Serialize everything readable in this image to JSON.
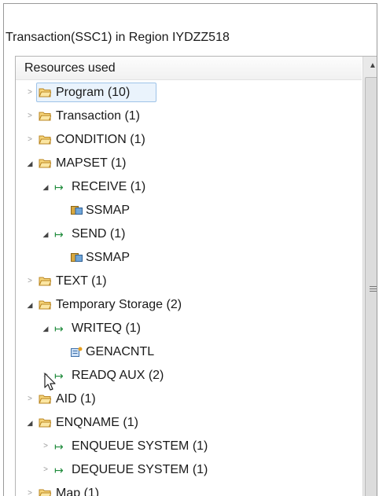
{
  "window": {
    "title": "Transaction(SSC1) in Region IYDZZ518"
  },
  "tree": {
    "header": "Resources used",
    "rows": [
      {
        "label": "Program",
        "count": "(10)",
        "icon": "folder-icon",
        "expanded": false,
        "selected": true
      },
      {
        "label": "Transaction",
        "count": "(1)",
        "icon": "folder-icon",
        "expanded": false
      },
      {
        "label": "CONDITION",
        "count": "(1)",
        "icon": "folder-icon",
        "expanded": false
      },
      {
        "label": "MAPSET",
        "count": "(1)",
        "icon": "folder-icon",
        "expanded": true
      },
      {
        "label": "RECEIVE",
        "count": "(1)",
        "icon": "arrow-icon",
        "expanded": true
      },
      {
        "label": "SSMAP",
        "count": "",
        "icon": "map-icon"
      },
      {
        "label": "SEND",
        "count": "(1)",
        "icon": "arrow-icon",
        "expanded": true
      },
      {
        "label": "SSMAP",
        "count": "",
        "icon": "map-icon"
      },
      {
        "label": "TEXT",
        "count": "(1)",
        "icon": "folder-icon",
        "expanded": false
      },
      {
        "label": "Temporary Storage",
        "count": "(2)",
        "icon": "folder-icon",
        "expanded": true
      },
      {
        "label": "WRITEQ",
        "count": "(1)",
        "icon": "arrow-icon",
        "expanded": true
      },
      {
        "label": "GENACNTL",
        "count": "",
        "icon": "queue-icon"
      },
      {
        "label": "READQ AUX",
        "count": "(2)",
        "icon": "arrow-icon",
        "expanded": false
      },
      {
        "label": "AID",
        "count": "(1)",
        "icon": "folder-icon",
        "expanded": false
      },
      {
        "label": "ENQNAME",
        "count": "(1)",
        "icon": "folder-icon",
        "expanded": true
      },
      {
        "label": "ENQUEUE SYSTEM",
        "count": "(1)",
        "icon": "arrow-icon",
        "expanded": false
      },
      {
        "label": "DEQUEUE SYSTEM",
        "count": "(1)",
        "icon": "arrow-icon",
        "expanded": false
      },
      {
        "label": "Map",
        "count": "(1)",
        "icon": "folder-icon",
        "expanded": false
      }
    ]
  },
  "colors": {
    "folder": "#e8b84a",
    "arrow": "#1d8a3a",
    "selection": "#eaf3fc"
  }
}
